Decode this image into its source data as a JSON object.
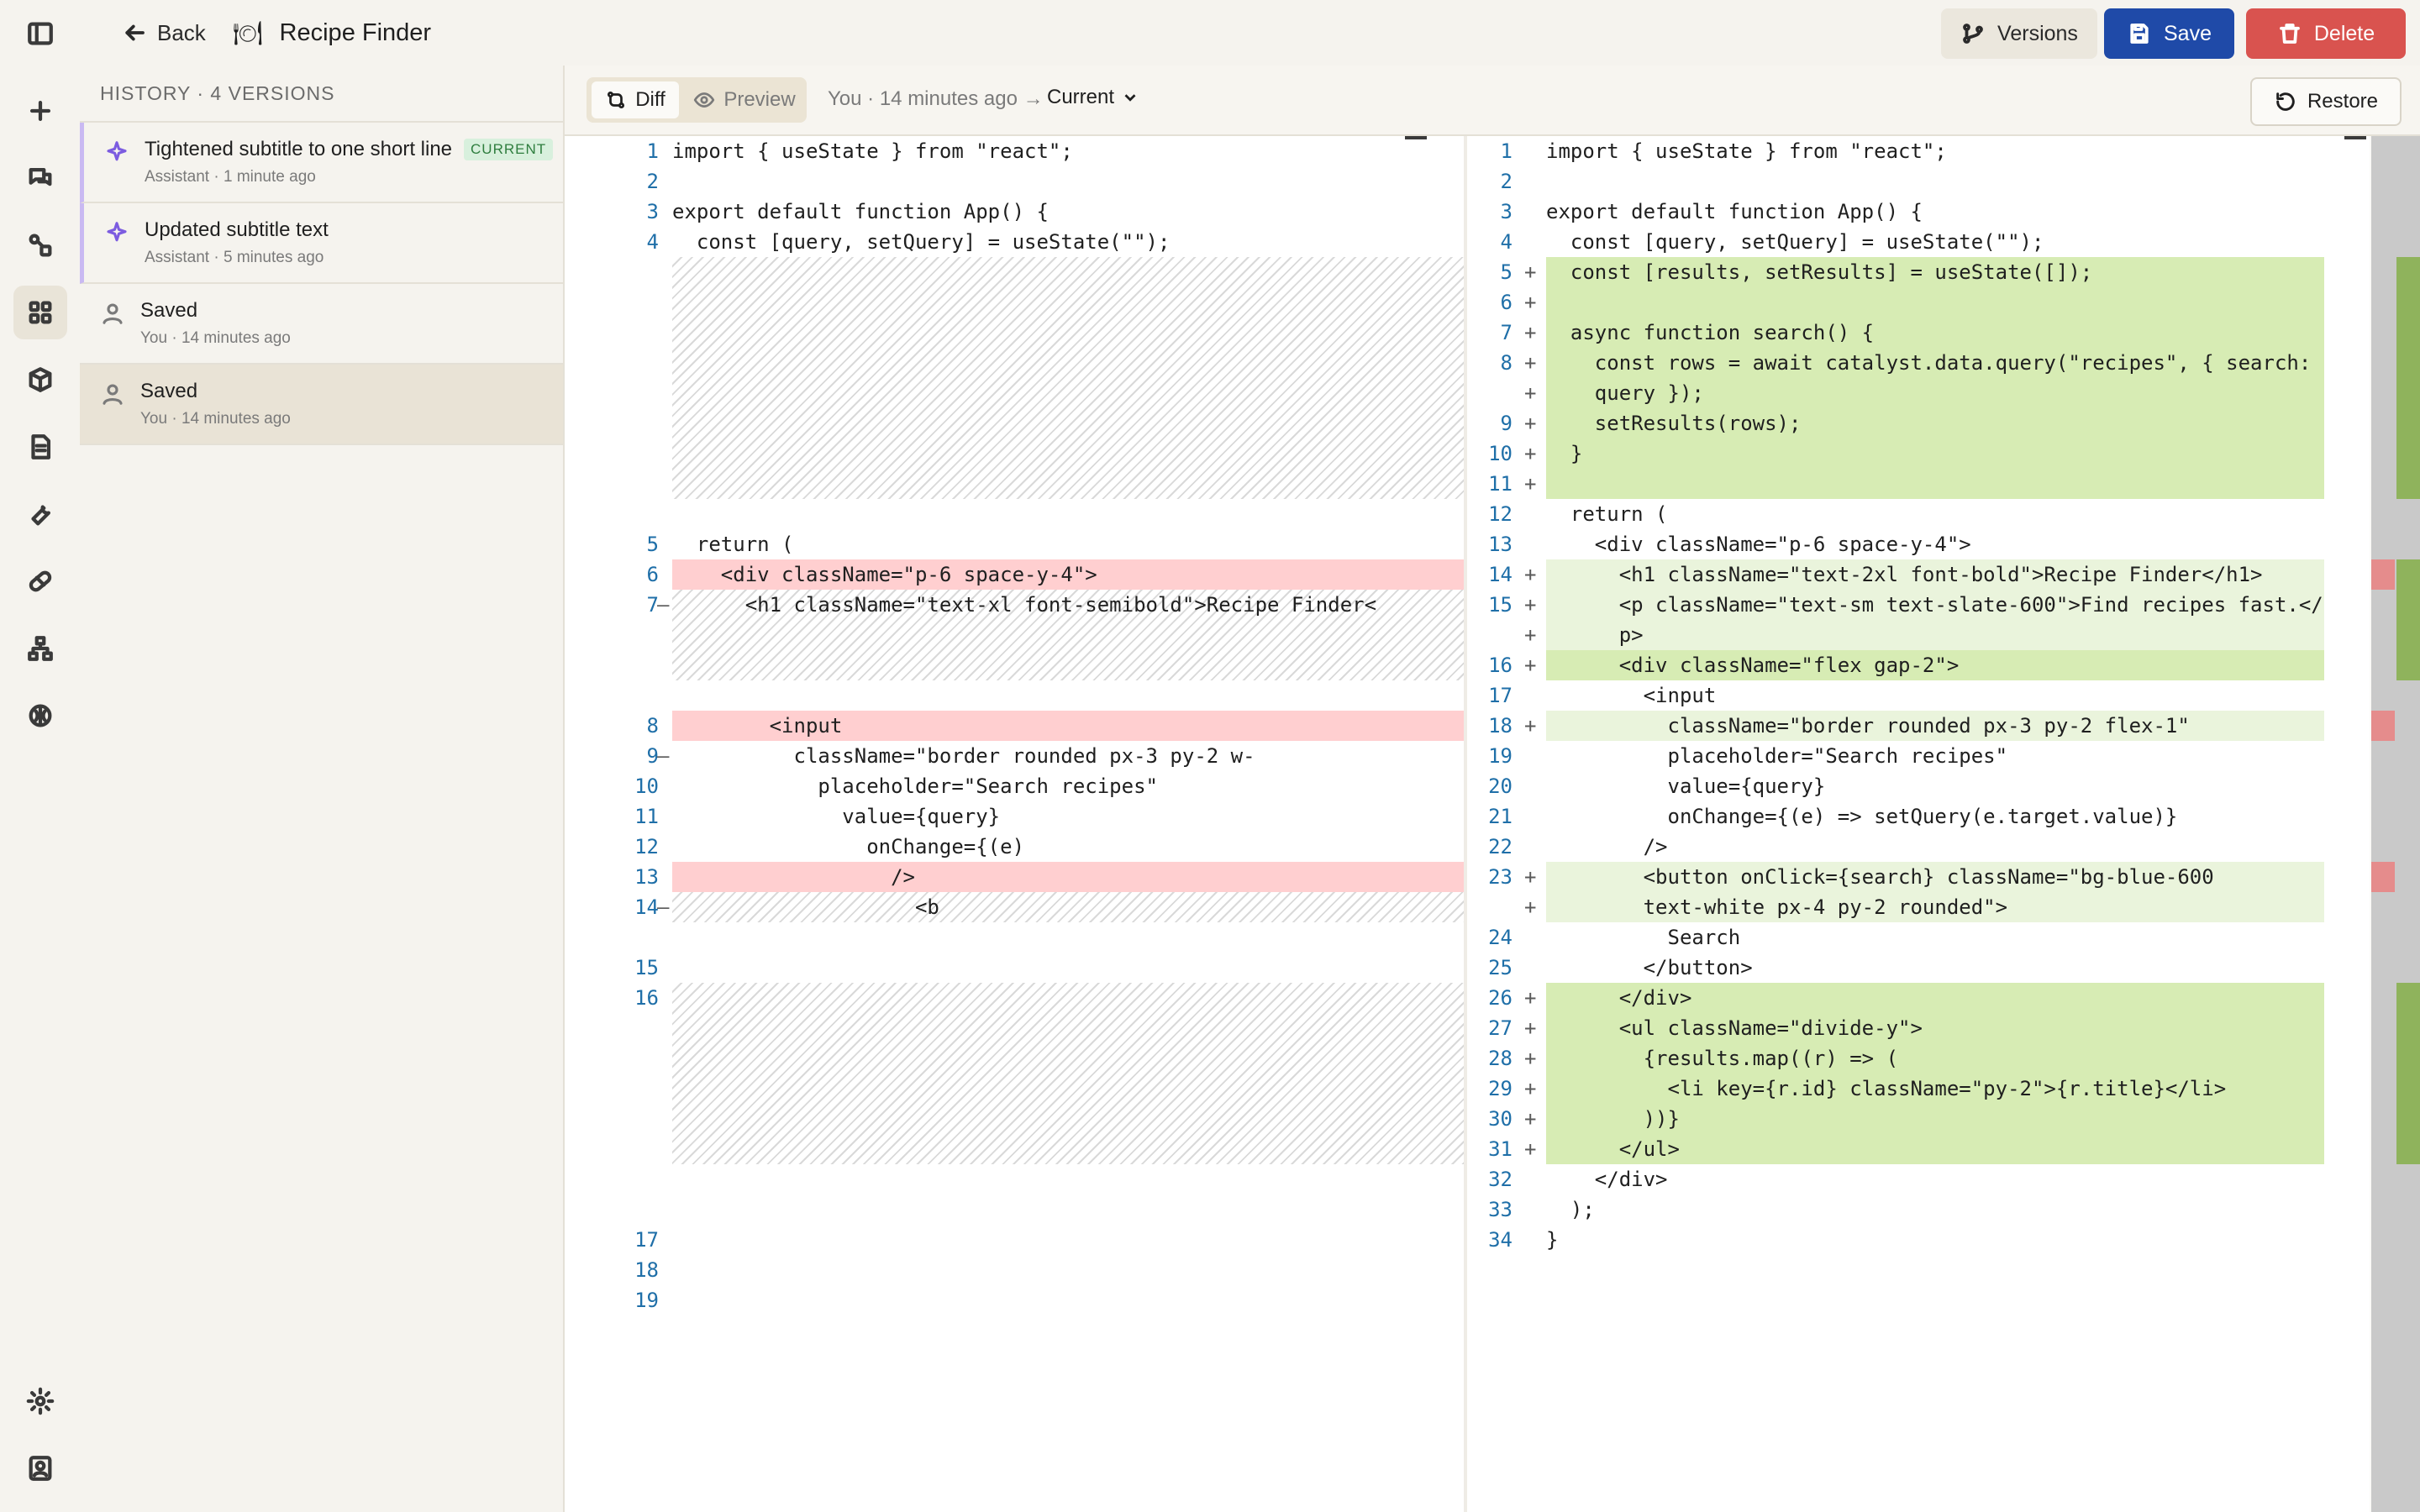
{
  "topbar": {
    "back_label": "Back",
    "app_title": "Recipe Finder",
    "versions_label": "Versions",
    "save_label": "Save",
    "delete_label": "Delete"
  },
  "rail": {
    "items": [
      "new-icon",
      "chat-icon",
      "shapes-icon",
      "apps-grid-icon",
      "package-icon",
      "document-icon",
      "tool-icon",
      "pill-icon",
      "sitemap-icon",
      "brain-icon"
    ],
    "bottom": [
      "settings-icon",
      "profile-icon"
    ]
  },
  "history": {
    "heading": "HISTORY · 4 VERSIONS",
    "versions": [
      {
        "title": "Tightened subtitle to one short line",
        "badge": "CURRENT",
        "sub": "Assistant · 1 minute ago",
        "author": "assistant"
      },
      {
        "title": "Updated subtitle text",
        "badge": "",
        "sub": "Assistant · 5 minutes ago",
        "author": "assistant"
      },
      {
        "title": "Saved",
        "badge": "",
        "sub": "You · 14 minutes ago",
        "author": "user"
      },
      {
        "title": "Saved",
        "badge": "",
        "sub": "You · 14 minutes ago",
        "author": "user"
      }
    ]
  },
  "diff_toolbar": {
    "diff_label": "Diff",
    "preview_label": "Preview",
    "compare_from": "You · 14 minutes ago →",
    "compare_to": "Current",
    "restore_label": "Restore"
  },
  "left_pane": [
    {
      "n": "1",
      "m": "",
      "t": "import { useState } from \"react\";"
    },
    {
      "n": "2",
      "m": "",
      "t": ""
    },
    {
      "n": "3",
      "m": "",
      "t": "export default function App() {"
    },
    {
      "n": "4",
      "m": "",
      "t": "  const [query, setQuery] = useState(\"\");"
    },
    {
      "n": "5",
      "m": "",
      "t": "  return ("
    },
    {
      "n": "6",
      "m": "",
      "t": "    <div className=\"p-6 space-y-4\">"
    },
    {
      "n": "7",
      "m": "–",
      "t": "      <h1 className=\"text-xl font-semibold\">Recipe Finder<"
    },
    {
      "n": "8",
      "m": "",
      "t": "        <input"
    },
    {
      "n": "9",
      "m": "–",
      "t": "          className=\"border rounded px-3 py-2 w-"
    },
    {
      "n": "10",
      "m": "",
      "t": "            placeholder=\"Search recipes\""
    },
    {
      "n": "11",
      "m": "",
      "t": "              value={query}"
    },
    {
      "n": "12",
      "m": "",
      "t": "                onChange={(e)"
    },
    {
      "n": "13",
      "m": "",
      "t": "                  />"
    },
    {
      "n": "14",
      "m": "–",
      "t": "                    <b"
    },
    {
      "n": "15",
      "m": "",
      "t": ""
    },
    {
      "n": "16",
      "m": "",
      "t": ""
    },
    {
      "n": "17",
      "m": "",
      "t": ""
    },
    {
      "n": "18",
      "m": "",
      "t": ""
    },
    {
      "n": "19",
      "m": "",
      "t": ""
    }
  ],
  "right_pane": [
    {
      "n": "1",
      "m": "",
      "t": "import { useState } from \"react\";"
    },
    {
      "n": "2",
      "m": "",
      "t": ""
    },
    {
      "n": "3",
      "m": "",
      "t": "export default function App() {"
    },
    {
      "n": "4",
      "m": "",
      "t": "  const [query, setQuery] = useState(\"\");"
    },
    {
      "n": "5",
      "m": "+",
      "t": "  const [results, setResults] = useState([]);"
    },
    {
      "n": "6",
      "m": "+",
      "t": ""
    },
    {
      "n": "7",
      "m": "+",
      "t": "  async function search() {"
    },
    {
      "n": "8",
      "m": "+",
      "t": "    const rows = await catalyst.data.query(\"recipes\", { search:"
    },
    {
      "n": "",
      "m": "+",
      "t": "    query });"
    },
    {
      "n": "9",
      "m": "+",
      "t": "    setResults(rows);"
    },
    {
      "n": "10",
      "m": "+",
      "t": "  }"
    },
    {
      "n": "11",
      "m": "+",
      "t": ""
    },
    {
      "n": "12",
      "m": "",
      "t": "  return ("
    },
    {
      "n": "13",
      "m": "",
      "t": "    <div className=\"p-6 space-y-4\">"
    },
    {
      "n": "14",
      "m": "+",
      "t": "      <h1 className=\"text-2xl font-bold\">Recipe Finder</h1>"
    },
    {
      "n": "15",
      "m": "+",
      "t": "      <p className=\"text-sm text-slate-600\">Find recipes fast.</"
    },
    {
      "n": "",
      "m": "+",
      "t": "      p>"
    },
    {
      "n": "16",
      "m": "+",
      "t": "      <div className=\"flex gap-2\">"
    },
    {
      "n": "17",
      "m": "",
      "t": "        <input"
    },
    {
      "n": "18",
      "m": "+",
      "t": "          className=\"border rounded px-3 py-2 flex-1\""
    },
    {
      "n": "19",
      "m": "",
      "t": "          placeholder=\"Search recipes\""
    },
    {
      "n": "20",
      "m": "",
      "t": "          value={query}"
    },
    {
      "n": "21",
      "m": "",
      "t": "          onChange={(e) => setQuery(e.target.value)}"
    },
    {
      "n": "22",
      "m": "",
      "t": "        />"
    },
    {
      "n": "23",
      "m": "+",
      "t": "        <button onClick={search} className=\"bg-blue-600"
    },
    {
      "n": "",
      "m": "+",
      "t": "        text-white px-4 py-2 rounded\">"
    },
    {
      "n": "24",
      "m": "",
      "t": "          Search"
    },
    {
      "n": "25",
      "m": "",
      "t": "        </button>"
    },
    {
      "n": "26",
      "m": "+",
      "t": "      </div>"
    },
    {
      "n": "27",
      "m": "+",
      "t": "      <ul className=\"divide-y\">"
    },
    {
      "n": "28",
      "m": "+",
      "t": "        {results.map((r) => ("
    },
    {
      "n": "29",
      "m": "+",
      "t": "          <li key={r.id} className=\"py-2\">{r.title}</li>"
    },
    {
      "n": "30",
      "m": "+",
      "t": "        ))}"
    },
    {
      "n": "31",
      "m": "+",
      "t": "      </ul>"
    },
    {
      "n": "32",
      "m": "",
      "t": "    </div>"
    },
    {
      "n": "33",
      "m": "",
      "t": "  );"
    },
    {
      "n": "34",
      "m": "",
      "t": "}"
    }
  ],
  "colors": {
    "accent": "#1f4aa8",
    "danger": "#d9534f",
    "added": "#d7ecb4",
    "removed": "#ffcfd0",
    "badge": "#2e7d3e"
  }
}
